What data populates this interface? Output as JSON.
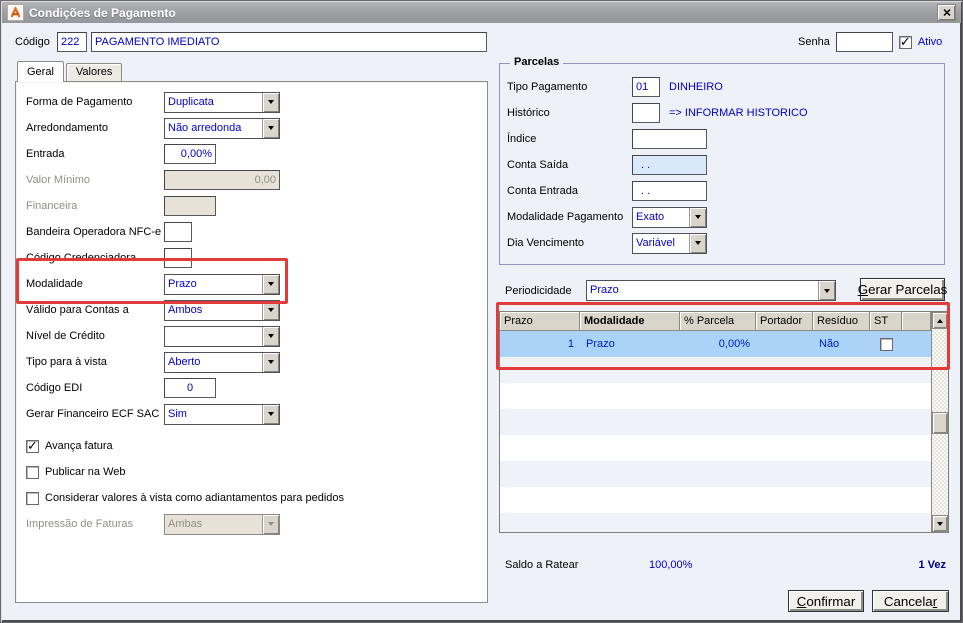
{
  "window": {
    "title": "Condições de Pagamento"
  },
  "header": {
    "codigo_label": "Código",
    "codigo_value": "222",
    "descricao_value": "PAGAMENTO IMEDIATO",
    "senha_label": "Senha",
    "senha_value": "",
    "ativo_label": "Ativo",
    "ativo_checked": true
  },
  "tabs": {
    "geral": "Geral",
    "valores": "Valores"
  },
  "geral": {
    "forma_pagamento": {
      "label": "Forma de Pagamento",
      "value": "Duplicata"
    },
    "arredondamento": {
      "label": "Arredondamento",
      "value": "Não arredonda"
    },
    "entrada": {
      "label": "Entrada",
      "value": "0,00%"
    },
    "valor_minimo": {
      "label": "Valor Mínimo",
      "value": "0,00",
      "disabled": true
    },
    "financeira": {
      "label": "Financeira",
      "value": "",
      "disabled": true
    },
    "bandeira_nfce": {
      "label": "Bandeira Operadora NFC-e",
      "value": ""
    },
    "codigo_credenciadora": {
      "label": "Código Credenciadora",
      "value": ""
    },
    "modalidade": {
      "label": "Modalidade",
      "value": "Prazo"
    },
    "valido_contas": {
      "label": "Válido para Contas a",
      "value": "Ambos"
    },
    "nivel_credito": {
      "label": "Nível de Crédito",
      "value": ""
    },
    "tipo_vista": {
      "label": "Tipo para à vista",
      "value": "Aberto"
    },
    "codigo_edi": {
      "label": "Código EDI",
      "value": "0"
    },
    "gerar_financeiro_ecf": {
      "label": "Gerar Financeiro ECF SAC",
      "value": "Sim"
    },
    "avanca_fatura": {
      "label": "Avança fatura",
      "checked": true
    },
    "publicar_web": {
      "label": "Publicar na Web",
      "checked": false
    },
    "considerar_vista": {
      "label": "Considerar valores à vista como adiantamentos para pedidos",
      "checked": false
    },
    "impressao_faturas": {
      "label": "Impressão de Faturas",
      "value": "Ambas",
      "disabled": true
    }
  },
  "parcelas": {
    "group_title": "Parcelas",
    "tipo_pagamento": {
      "label": "Tipo Pagamento",
      "value": "01",
      "description": "DINHEIRO"
    },
    "historico": {
      "label": "Histórico",
      "value": "",
      "description": "=> INFORMAR HISTORICO"
    },
    "indice": {
      "label": "Índice",
      "value": ""
    },
    "conta_saida": {
      "label": "Conta Saída",
      "value": ". ."
    },
    "conta_entrada": {
      "label": "Conta Entrada",
      "value": ". ."
    },
    "modalidade_pagamento": {
      "label": "Modalidade Pagamento",
      "value": "Exato"
    },
    "dia_vencimento": {
      "label": "Dia Vencimento",
      "value": "Variável"
    }
  },
  "periodicidade": {
    "label": "Periodicidade",
    "value": "Prazo",
    "gerar_button_u": "G",
    "gerar_button_rest": "erar Parcelas"
  },
  "table": {
    "columns": {
      "prazo": "Prazo",
      "modalidade": "Modalidade",
      "parcela": "% Parcela",
      "portador": "Portador",
      "residuo": "Resíduo",
      "st": "ST"
    },
    "rows": [
      {
        "prazo": "1",
        "modalidade": "Prazo",
        "parcela": "0,00%",
        "portador": "",
        "residuo": "Não",
        "st_checked": false,
        "selected": true
      }
    ]
  },
  "footer": {
    "saldo_label": "Saldo a Ratear",
    "saldo_value": "100,00%",
    "vezes_value": "1 Vez",
    "confirmar_u": "C",
    "confirmar_rest": "onfirmar",
    "cancelar_pre": "Cancela",
    "cancelar_u": "r"
  },
  "colors": {
    "value_text": "#0000C8",
    "navy_bold": "#000080",
    "selected_row": "#ABD3F8",
    "annotation_red": "#E23B3B",
    "titlebar_gray": "#9D9EA1"
  }
}
